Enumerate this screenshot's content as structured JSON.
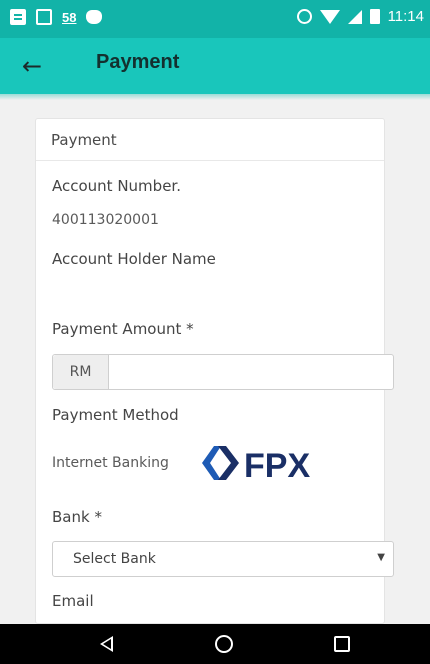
{
  "status_bar": {
    "notification_count": "58",
    "time": "11:14",
    "icons": [
      "message-icon",
      "image-icon",
      "android-icon",
      "alarm-icon",
      "wifi-icon",
      "signal-icon",
      "battery-icon"
    ]
  },
  "app_bar": {
    "back_icon": "←",
    "title": "Payment",
    "color": "#19c6bb"
  },
  "form": {
    "header": "Payment",
    "account_number_label": "Account Number.",
    "account_number_value": "400113020001",
    "account_holder_label": "Account Holder Name",
    "payment_amount_label": "Payment Amount *",
    "currency_addon": "RM",
    "payment_amount_value": "",
    "payment_method_label": "Payment Method",
    "payment_method_value": "Internet Banking",
    "fpx_logo_text": "FPX",
    "bank_label": "Bank *",
    "bank_select": {
      "selected": "Select Bank",
      "caret": "▼"
    },
    "email_label": "Email"
  },
  "nav_bar": {
    "buttons": [
      "back-icon",
      "home-icon",
      "recent-apps-icon"
    ]
  }
}
